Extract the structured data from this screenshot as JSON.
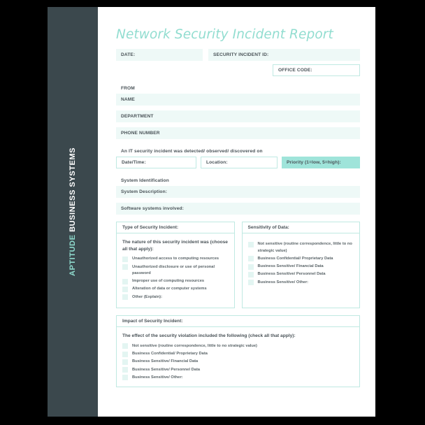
{
  "brand": {
    "accent_word": "APTITUDE",
    "rest_word": " BUSINESS SYSTEMS",
    "accent_color": "#8ed9cc",
    "sidebar_color": "#3b484d"
  },
  "theme": {
    "title_color": "#92ddd0",
    "tint_fill": "#eef9f7",
    "solid_fill": "#9fe4da",
    "border_color": "#bfe9e2",
    "checkbox_fill": "#e3f5f2",
    "text_color": "#4a5358"
  },
  "document": {
    "title": "Network Security Incident Report"
  },
  "header_fields": {
    "date": "DATE:",
    "security_incident_id": "SECURITY INCIDENT ID:",
    "office_code": "OFFICE CODE:"
  },
  "from_section": {
    "heading": "FROM",
    "name": "NAME",
    "department": "DEPARTMENT",
    "phone_number": "PHONE NUMBER"
  },
  "detection": {
    "statement": "An IT security incident was detected/ observed/ discovered on",
    "date_time": "Date/Time:",
    "location": "Location:",
    "priority": "Priority (1=low, 5=high):"
  },
  "system_identification": {
    "heading": "System Identification",
    "system_description": "System Description:",
    "software_systems": "Software systems involved:"
  },
  "type_of_incident": {
    "heading": "Type of Security Incident:",
    "intro": "The nature of this security incident was (choose all that apply):",
    "options": [
      "Unauthorized access to computing resources",
      "Unauthorized disclosure or use of personal password",
      "Improper use of computing resources",
      "Alteration of data or computer systems",
      "Other (Explain):"
    ]
  },
  "sensitivity_of_data": {
    "heading": "Sensitivity of Data:",
    "options": [
      "Not sensitive (routine correspondence, little to no strategic value)",
      "Business Confidential/ Proprietary Data",
      "Business Sensitive/ Financial Data",
      "Business Sensitive/ Personnel Data",
      "Business Sensitive/ Other:"
    ]
  },
  "impact_of_incident": {
    "heading": "Impact of Security Incident:",
    "intro": "The effect of the security violation included the following (check all that apply):",
    "options": [
      "Not sensitive (routine correspondence, little to no strategic value)",
      "Business Confidential/ Proprietary Data",
      "Business Sensitive/ Financial Data",
      "Business Sensitive/ Personnel Data",
      "Business Sensitive/ Other:"
    ]
  }
}
